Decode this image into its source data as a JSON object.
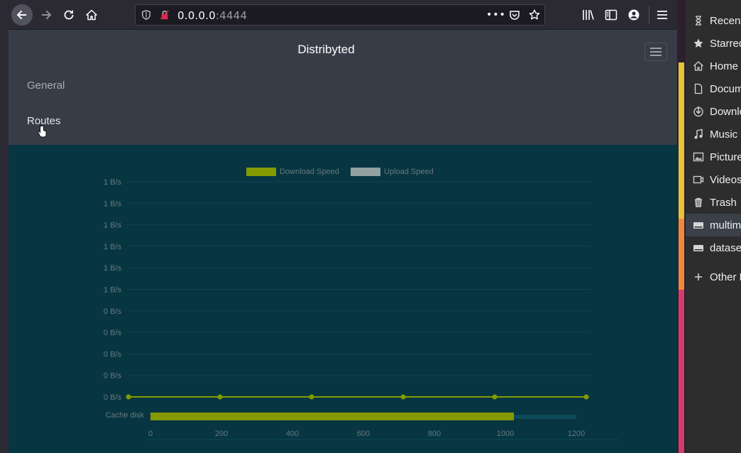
{
  "browser": {
    "url_host": "0.0.0.0",
    "url_port": ":4444",
    "more_glyph": "•••"
  },
  "app": {
    "brand": "Distribyted",
    "nav": [
      "General",
      "Routes"
    ]
  },
  "chart_data": [
    {
      "type": "line",
      "legend": [
        "Download Speed",
        "Upload Speed"
      ],
      "series_colors": [
        "#859900",
        "#93a1a1"
      ],
      "y_tick_labels": [
        "1 B/s",
        "1 B/s",
        "1 B/s",
        "1 B/s",
        "1 B/s",
        "1 B/s",
        "0 B/s",
        "0 B/s",
        "0 B/s",
        "0 B/s",
        "0 B/s"
      ],
      "series": [
        {
          "name": "Download Speed",
          "values": [
            0,
            0,
            0,
            0,
            0,
            0
          ]
        }
      ],
      "grid": true
    },
    {
      "type": "bar",
      "orientation": "horizontal",
      "categories": [
        "Cache disk"
      ],
      "values": [
        1024
      ],
      "xlim": [
        0,
        1300
      ],
      "x_tick_labels": [
        "0",
        "200",
        "400",
        "600",
        "800",
        "1000",
        "1200"
      ],
      "color": "#859900"
    }
  ],
  "files_sidebar": {
    "items": [
      {
        "label": "Recent",
        "icon": "recent-icon"
      },
      {
        "label": "Starred",
        "icon": "star-icon"
      },
      {
        "label": "Home",
        "icon": "home-icon"
      },
      {
        "label": "Documents",
        "icon": "document-icon"
      },
      {
        "label": "Downloads",
        "icon": "download-icon"
      },
      {
        "label": "Music",
        "icon": "music-icon"
      },
      {
        "label": "Pictures",
        "icon": "pictures-icon"
      },
      {
        "label": "Videos",
        "icon": "videos-icon"
      },
      {
        "label": "Trash",
        "icon": "trash-icon"
      },
      {
        "label": "multimedia",
        "icon": "drive-icon"
      },
      {
        "label": "dataset",
        "icon": "drive-icon"
      },
      {
        "label": "Other Locations",
        "icon": "plus-icon"
      }
    ]
  }
}
